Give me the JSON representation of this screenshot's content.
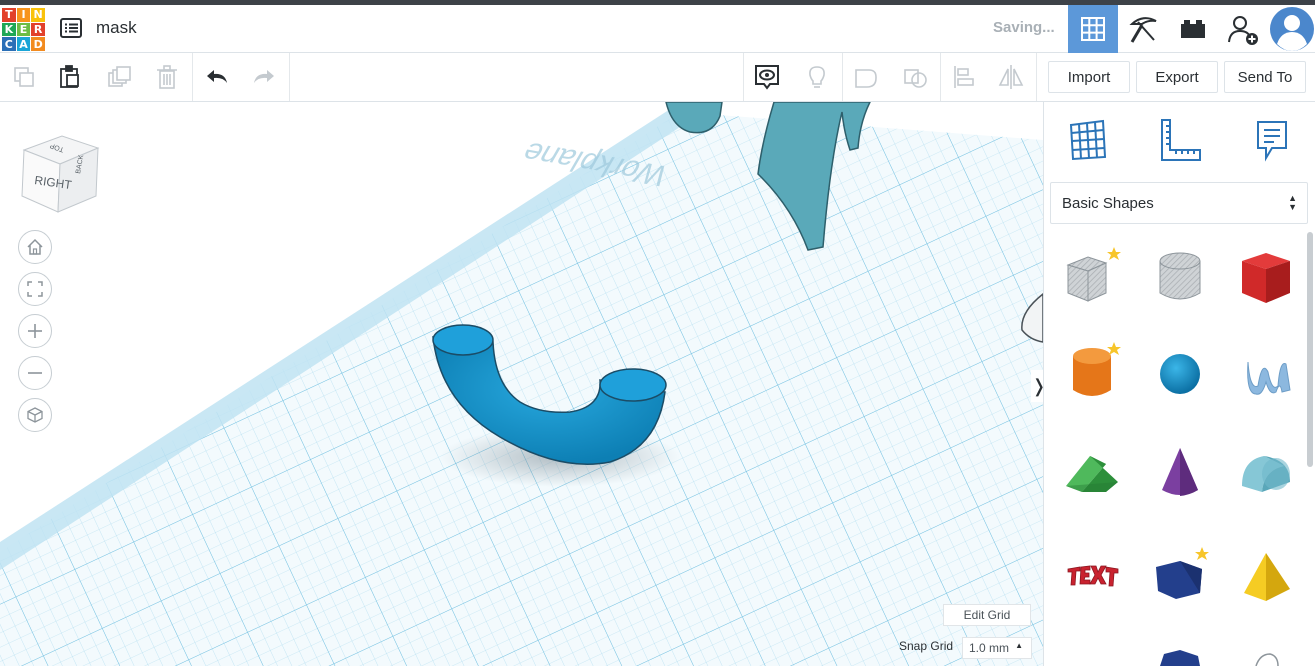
{
  "app": {
    "logo_letters": [
      "T",
      "I",
      "N",
      "K",
      "E",
      "R",
      "C",
      "A",
      "D"
    ],
    "logo_colors": [
      "#e2412b",
      "#f7941d",
      "#f9c20b",
      "#1fa756",
      "#6bbd45",
      "#e2412b",
      "#2a6fb7",
      "#1aa5d7",
      "#f28b20"
    ]
  },
  "header": {
    "design_name": "mask",
    "status": "Saving...",
    "icons": [
      "3d-view-grid-icon",
      "codeblocks-pickaxe-icon",
      "bricks-icon",
      "invite-user-icon",
      "avatar"
    ]
  },
  "toolbar": {
    "buttons": [
      "copy-icon",
      "paste-icon",
      "duplicate-icon",
      "delete-icon",
      "undo-icon",
      "redo-icon",
      "show-all-icon",
      "light-bulb-icon",
      "group-icon",
      "ungroup-icon",
      "align-icon",
      "mirror-icon"
    ],
    "import_label": "Import",
    "export_label": "Export",
    "send_to_label": "Send To"
  },
  "viewcube": {
    "front": "RIGHT",
    "top": "TOP",
    "side": "BACK"
  },
  "workplane": {
    "label": "Workplane"
  },
  "panel": {
    "category": "Basic Shapes",
    "shapes": [
      {
        "name": "Box (hole)",
        "color": "#c4c9ce",
        "favorite": true
      },
      {
        "name": "Cylinder (hole)",
        "color": "#c4c9ce",
        "favorite": false
      },
      {
        "name": "Box",
        "color": "#d62a2a",
        "favorite": false
      },
      {
        "name": "Cylinder",
        "color": "#ea7a1b",
        "favorite": true
      },
      {
        "name": "Sphere",
        "color": "#1591c9",
        "favorite": false
      },
      {
        "name": "Scribble",
        "color": "#8ab6de",
        "favorite": false
      },
      {
        "name": "Roof",
        "color": "#3aa14a",
        "favorite": false
      },
      {
        "name": "Cone",
        "color": "#7b3fa0",
        "favorite": false
      },
      {
        "name": "Round Roof",
        "color": "#66b4c6",
        "favorite": false
      },
      {
        "name": "Text",
        "color": "#c9222f",
        "favorite": false
      },
      {
        "name": "Polygon",
        "color": "#233f8c",
        "favorite": true
      },
      {
        "name": "Pyramid",
        "color": "#f2c417",
        "favorite": false
      }
    ]
  },
  "grid": {
    "edit_label": "Edit Grid",
    "snap_label": "Snap Grid",
    "snap_value": "1.0 mm"
  },
  "colors": {
    "accent": "#5c98d9",
    "grid_line": "#9fd4ea",
    "workplane": "#f1f9fd",
    "torus": "#1a9ad0"
  }
}
